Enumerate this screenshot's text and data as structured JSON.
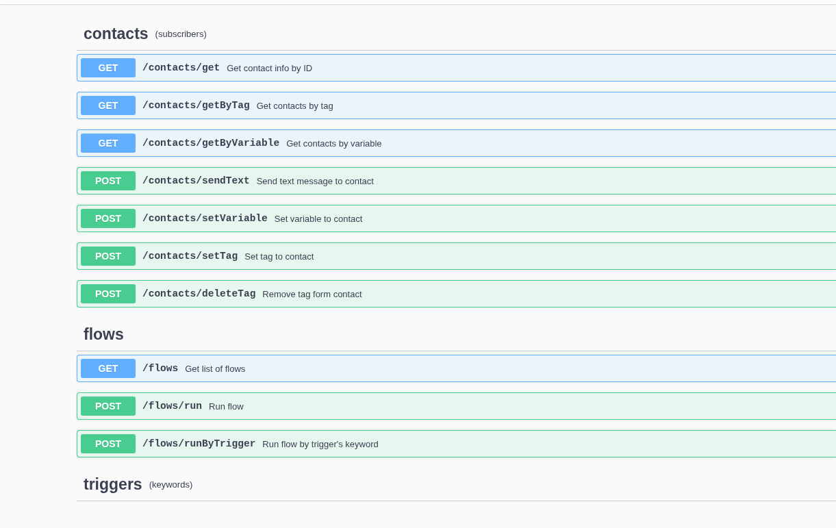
{
  "sections": [
    {
      "title": "contacts",
      "description": "(subscribers)",
      "operations": [
        {
          "kind": "get",
          "method": "GET",
          "path": "/contacts/get",
          "summary": "Get contact info by ID"
        },
        {
          "kind": "get",
          "method": "GET",
          "path": "/contacts/getByTag",
          "summary": "Get contacts by tag"
        },
        {
          "kind": "get",
          "method": "GET",
          "path": "/contacts/getByVariable",
          "summary": "Get contacts by variable"
        },
        {
          "kind": "post",
          "method": "POST",
          "path": "/contacts/sendText",
          "summary": "Send text message to contact"
        },
        {
          "kind": "post",
          "method": "POST",
          "path": "/contacts/setVariable",
          "summary": "Set variable to contact"
        },
        {
          "kind": "post",
          "method": "POST",
          "path": "/contacts/setTag",
          "summary": "Set tag to contact"
        },
        {
          "kind": "post",
          "method": "POST",
          "path": "/contacts/deleteTag",
          "summary": "Remove tag form contact"
        }
      ]
    },
    {
      "title": "flows",
      "operations": [
        {
          "kind": "get",
          "method": "GET",
          "path": "/flows",
          "summary": "Get list of flows"
        },
        {
          "kind": "post",
          "method": "POST",
          "path": "/flows/run",
          "summary": "Run flow"
        },
        {
          "kind": "post",
          "method": "POST",
          "path": "/flows/runByTrigger",
          "summary": "Run flow by trigger's keyword"
        }
      ]
    },
    {
      "title": "triggers",
      "description": "(keywords)"
    }
  ]
}
